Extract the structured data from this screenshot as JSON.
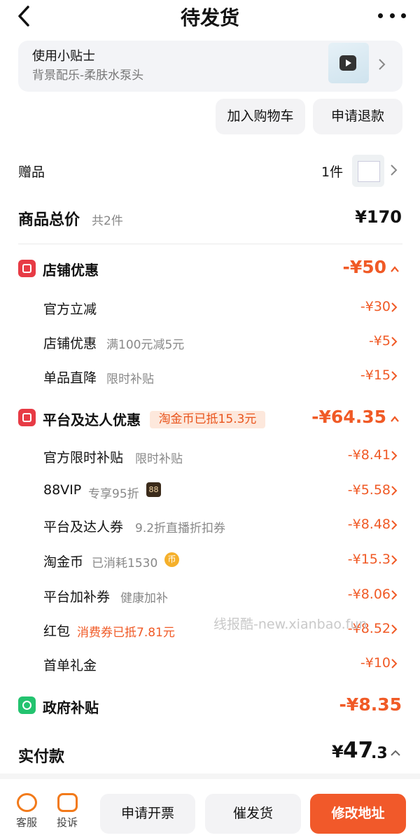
{
  "header": {
    "title": "待发货"
  },
  "tip": {
    "title": "使用小贴士",
    "subtitle": "背景配乐-柔肤水泵头"
  },
  "actions": {
    "cart": "加入购物车",
    "refund": "申请退款"
  },
  "gift": {
    "label": "赠品",
    "count": "1件"
  },
  "total": {
    "label": "商品总价",
    "count": "共2件",
    "value": "¥170"
  },
  "shop": {
    "title": "店铺优惠",
    "value": "-¥50",
    "rows": [
      {
        "label": "官方立减",
        "note": "",
        "value": "-¥30"
      },
      {
        "label": "店铺优惠",
        "note": "满100元减5元",
        "value": "-¥5"
      },
      {
        "label": "单品直降",
        "note": "限时补贴",
        "value": "-¥15"
      }
    ]
  },
  "platform": {
    "title": "平台及达人优惠",
    "badge": "淘金币已抵15.3元",
    "value": "-¥64.35",
    "rows": [
      {
        "label": "官方限时补贴",
        "note": "限时补贴",
        "value": "-¥8.41"
      },
      {
        "label": "88VIP",
        "note": "专享95折",
        "badge": "88",
        "value": "-¥5.58"
      },
      {
        "label": "平台及达人券",
        "note": "9.2折直播折扣券",
        "value": "-¥8.48"
      },
      {
        "label": "淘金币",
        "note": "已消耗1530",
        "badge": "币",
        "value": "-¥15.3"
      },
      {
        "label": "平台加补券",
        "note": "健康加补",
        "value": "-¥8.06"
      },
      {
        "label": "红包",
        "note": "消费券已抵7.81元",
        "value": "-¥8.52"
      },
      {
        "label": "首单礼金",
        "note": "",
        "value": "-¥10"
      }
    ]
  },
  "gov": {
    "title": "政府补贴",
    "value": "-¥8.35"
  },
  "paid": {
    "label": "实付款",
    "symbol": "¥",
    "integer": "47",
    "decimal": ".3"
  },
  "watermark": "线报酷-new.xianbao.fun",
  "bottom": {
    "service": "客服",
    "complain": "投诉",
    "invoice": "申请开票",
    "urge": "催发货",
    "address": "修改地址"
  },
  "colors": {
    "accent": "#f05a26",
    "red_icon": "#e73b45",
    "green_icon": "#23c36f",
    "primary_button": "#f1592a"
  }
}
